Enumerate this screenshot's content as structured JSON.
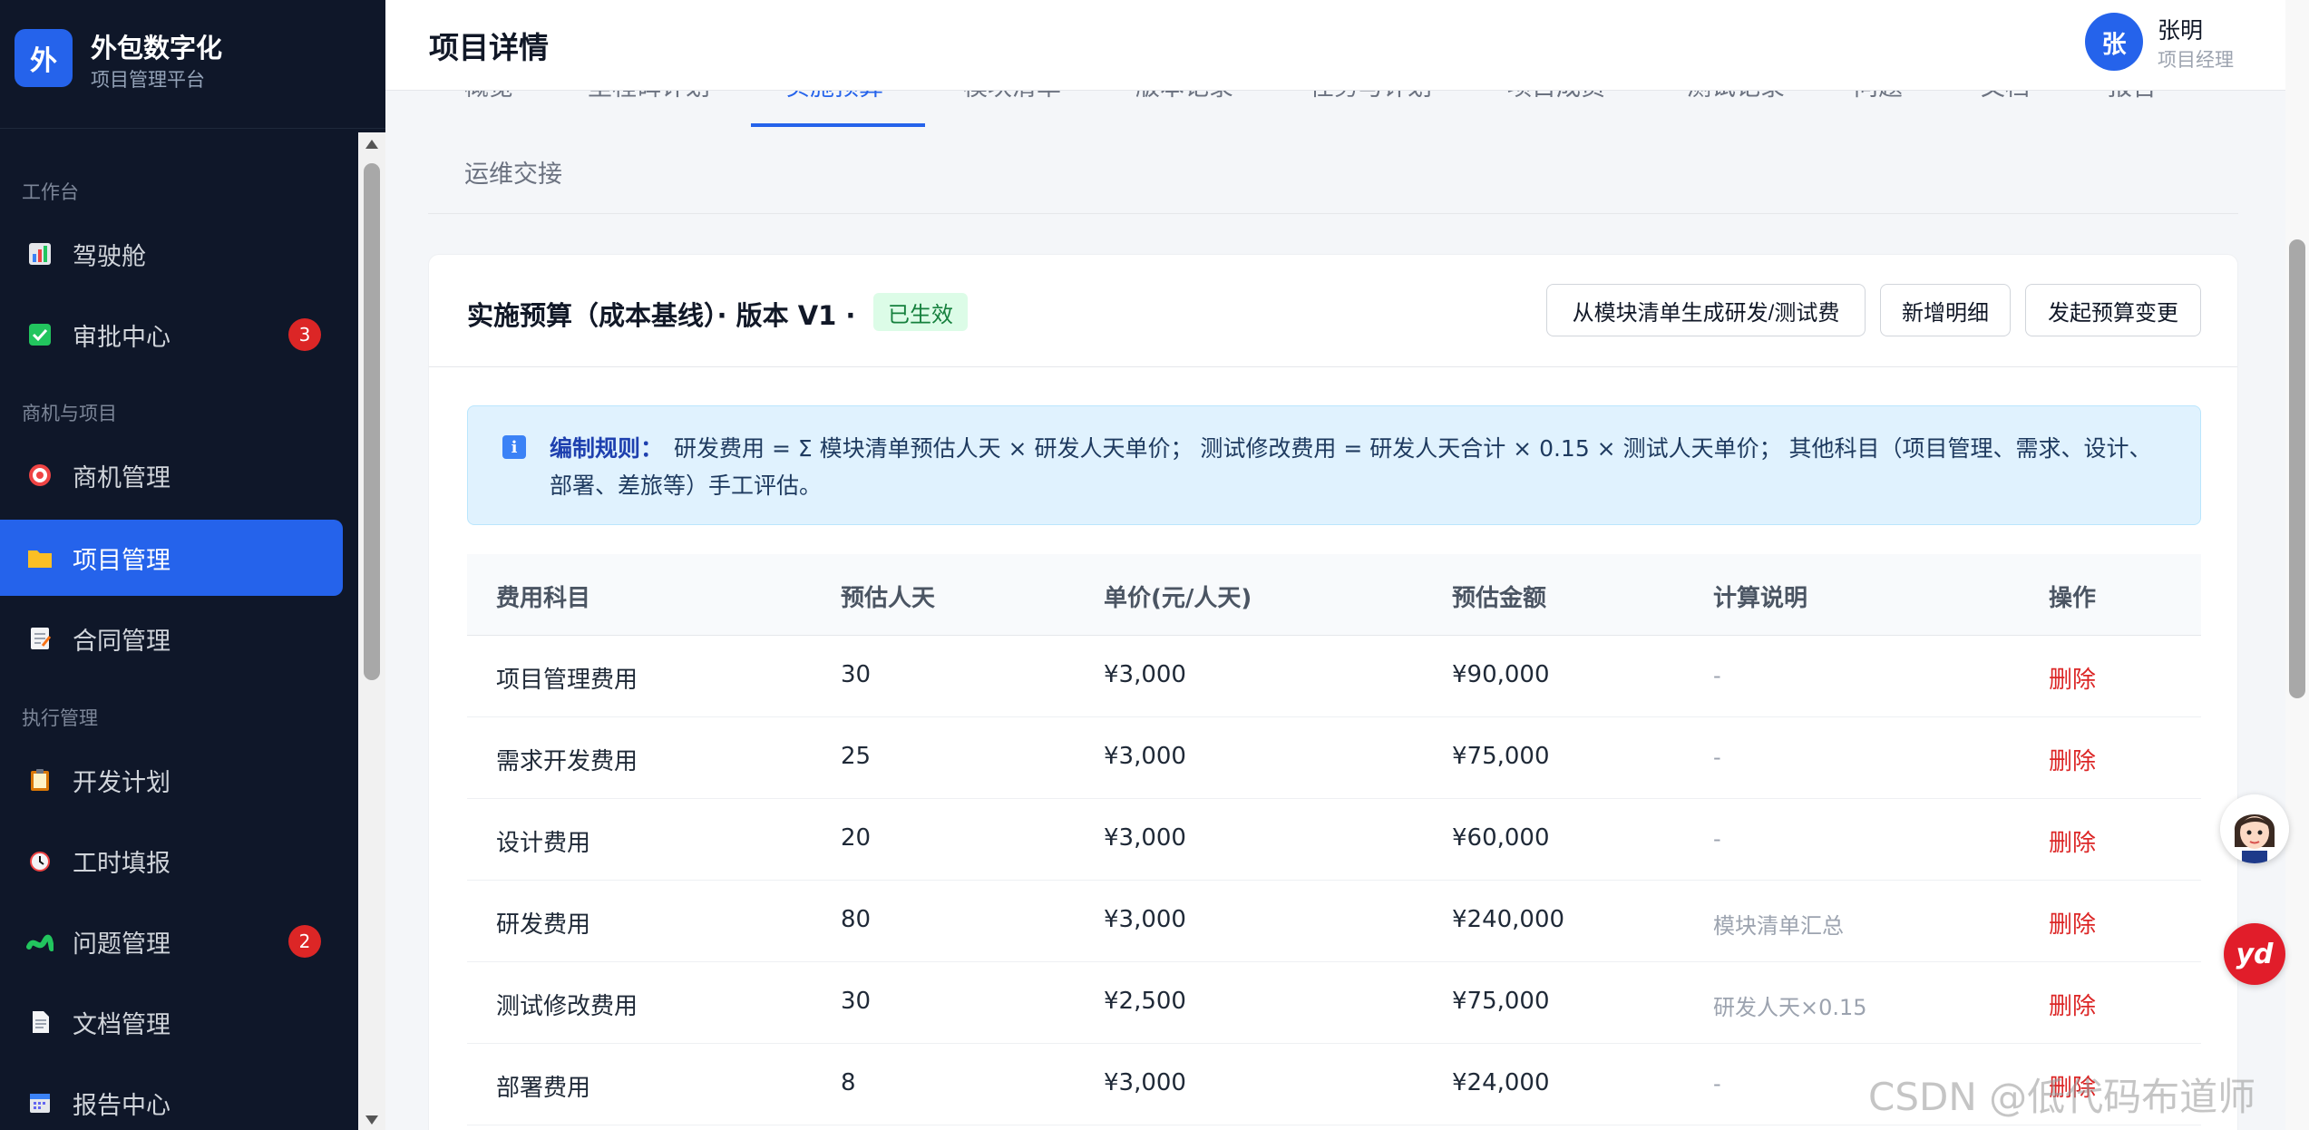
{
  "brand": {
    "logo": "外",
    "name": "外包数字化",
    "subtitle": "项目管理平台"
  },
  "sidebar": {
    "groups": [
      {
        "label": "工作台"
      },
      {
        "label": "商机与项目"
      },
      {
        "label": "执行管理"
      }
    ],
    "items": [
      {
        "label": "驾驶舱",
        "icon": "dashboard-chart-icon"
      },
      {
        "label": "审批中心",
        "icon": "approval-check-icon",
        "badge": "3"
      },
      {
        "label": "商机管理",
        "icon": "target-icon"
      },
      {
        "label": "项目管理",
        "icon": "folder-icon",
        "active": true
      },
      {
        "label": "合同管理",
        "icon": "memo-icon"
      },
      {
        "label": "开发计划",
        "icon": "clipboard-icon"
      },
      {
        "label": "工时填报",
        "icon": "alarm-clock-icon"
      },
      {
        "label": "问题管理",
        "icon": "bug-icon",
        "badge": "2"
      },
      {
        "label": "文档管理",
        "icon": "document-icon"
      },
      {
        "label": "报告中心",
        "icon": "calendar-icon"
      }
    ]
  },
  "header": {
    "title": "项目详情"
  },
  "user": {
    "avatar": "张",
    "name": "张明",
    "role": "项目经理"
  },
  "tabs": {
    "items": [
      {
        "label": "概览"
      },
      {
        "label": "里程碑计划"
      },
      {
        "label": "实施预算",
        "active": true
      },
      {
        "label": "模块清单"
      },
      {
        "label": "版本记录"
      },
      {
        "label": "任务与计划"
      },
      {
        "label": "项目成员"
      },
      {
        "label": "测试记录"
      },
      {
        "label": "问题"
      },
      {
        "label": "文档"
      },
      {
        "label": "报告"
      },
      {
        "label": "运维交接"
      }
    ]
  },
  "budget": {
    "title": "实施预算（成本基线）· 版本 V1 ·",
    "status": "已生效",
    "buttons": {
      "generate": "从模块清单生成研发/测试费",
      "add": "新增明细",
      "change": "发起预算变更"
    },
    "rule": {
      "label": "编制规则：",
      "text": "研发费用 = Σ 模块清单预估人天 × 研发人天单价； 测试修改费用 = 研发人天合计 × 0.15 × 测试人天单价； 其他科目（项目管理、需求、设计、部署、差旅等）手工评估。"
    },
    "table": {
      "headers": [
        "费用科目",
        "预估人天",
        "单价(元/人天)",
        "预估金额",
        "计算说明",
        "操作"
      ],
      "rows": [
        {
          "item": "项目管理费用",
          "days": "30",
          "price": "¥3,000",
          "amount": "¥90,000",
          "note": "-",
          "action": "删除"
        },
        {
          "item": "需求开发费用",
          "days": "25",
          "price": "¥3,000",
          "amount": "¥75,000",
          "note": "-",
          "action": "删除"
        },
        {
          "item": "设计费用",
          "days": "20",
          "price": "¥3,000",
          "amount": "¥60,000",
          "note": "-",
          "action": "删除"
        },
        {
          "item": "研发费用",
          "days": "80",
          "price": "¥3,000",
          "amount": "¥240,000",
          "note": "模块清单汇总",
          "action": "删除"
        },
        {
          "item": "测试修改费用",
          "days": "30",
          "price": "¥2,500",
          "amount": "¥75,000",
          "note": "研发人天×0.15",
          "action": "删除"
        },
        {
          "item": "部署费用",
          "days": "8",
          "price": "¥3,000",
          "amount": "¥24,000",
          "note": "-",
          "action": "删除"
        }
      ]
    }
  },
  "float": {
    "yd": "yd"
  },
  "watermark": "CSDN @低代码布道师"
}
